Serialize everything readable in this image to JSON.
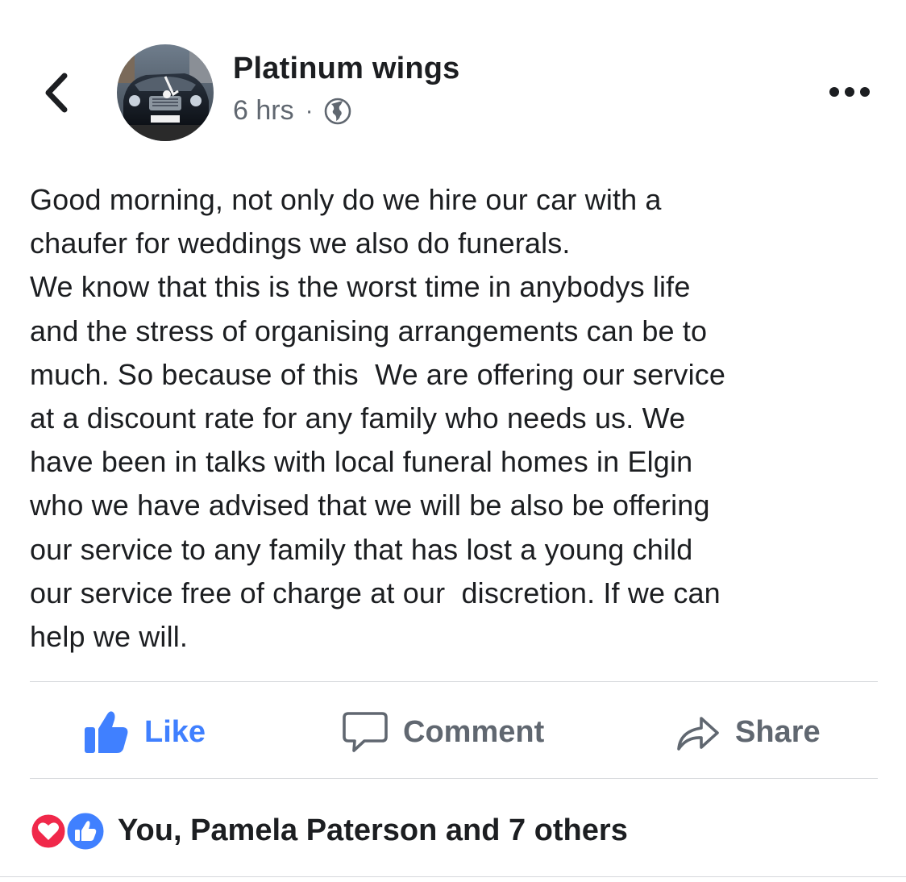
{
  "header": {
    "page_name": "Platinum wings",
    "time_ago": "6 hrs",
    "separator": "·",
    "privacy_icon": "globe-icon",
    "back_icon": "chevron-left-icon",
    "more_icon": "more-options-icon"
  },
  "avatar": {
    "plate_text": "NV06 JAC"
  },
  "post": {
    "text": "Good morning, not only do we hire our car with a\nchaufer for weddings we also do funerals.\nWe know that this is the worst time in anybodys life\nand the stress of organising arrangements can be to\nmuch. So because of this  We are offering our service\nat a discount rate for any family who needs us. We\nhave been in talks with local funeral homes in Elgin\nwho we have advised that we will be also be offering\nour service to any family that has lost a young child\nour service free of charge at our  discretion. If we can\nhelp we will."
  },
  "actions": {
    "like_label": "Like",
    "comment_label": "Comment",
    "share_label": "Share"
  },
  "reactions": {
    "summary": "You, Pamela Paterson and 7 others",
    "icons": [
      "heart-icon",
      "thumbs-up-icon"
    ]
  },
  "colors": {
    "like_blue": "#4080ff",
    "love_red": "#f0284a",
    "muted_gray": "#606770",
    "text_dark": "#1c1e21"
  }
}
